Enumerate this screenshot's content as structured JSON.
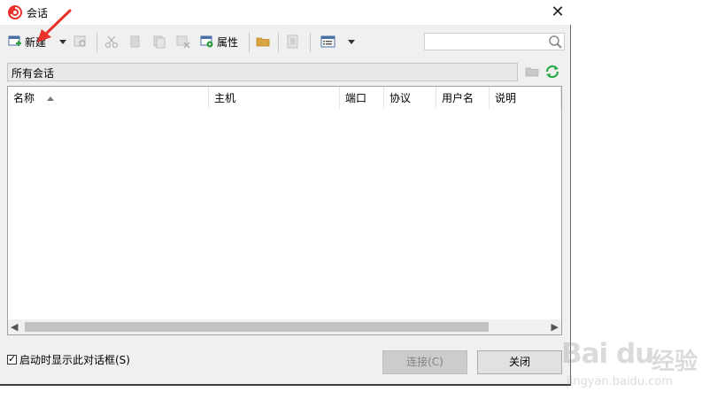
{
  "window": {
    "title": "会话",
    "close_symbol": "✕"
  },
  "toolbar": {
    "new_label": "新建",
    "properties_label": "属性"
  },
  "search": {
    "value": "",
    "placeholder": ""
  },
  "path": {
    "label": "所有会话"
  },
  "table": {
    "columns": [
      "名称",
      "主机",
      "端口",
      "协议",
      "用户名",
      "说明"
    ],
    "sorted_column": "名称",
    "sort_direction": "ascending",
    "rows": []
  },
  "footer": {
    "show_on_startup_label": "启动时显示此对话框(S)",
    "show_on_startup_checked": true,
    "check_mark": "✓",
    "connect_label": "连接(C)",
    "close_label": "关闭"
  },
  "watermark": {
    "brand": "Bai du",
    "brand_cn": "经验",
    "url": "jingyan.baidu.com"
  },
  "colors": {
    "accent_red": "#e8322b",
    "refresh_green": "#27a845",
    "new_plus_green": "#2e9e3d"
  }
}
